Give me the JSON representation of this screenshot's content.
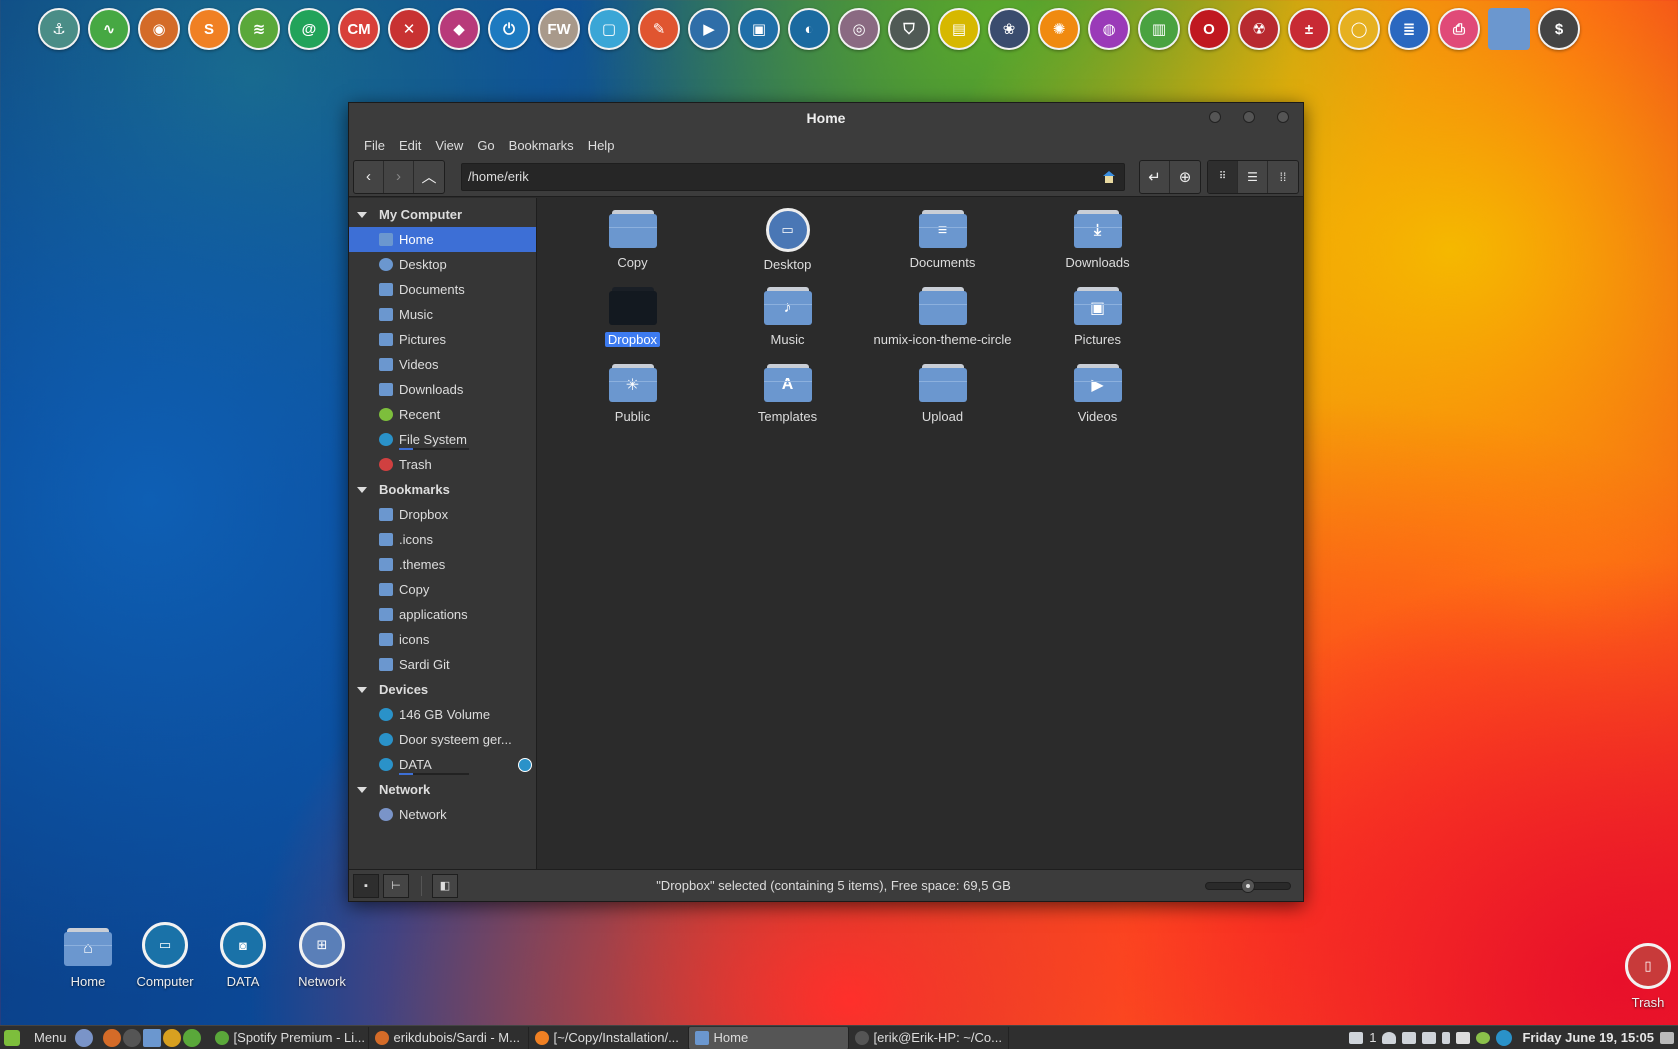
{
  "dock": {
    "items": [
      {
        "name": "anchor",
        "color": "#4a8d87",
        "glyph": "⚓"
      },
      {
        "name": "system-monitor",
        "color": "#46a843",
        "glyph": "∿"
      },
      {
        "name": "firefox",
        "color": "#d46b28",
        "glyph": "◉"
      },
      {
        "name": "sublime",
        "color": "#f08023",
        "glyph": "S"
      },
      {
        "name": "spotify",
        "color": "#5aa83a",
        "glyph": "≋"
      },
      {
        "name": "email",
        "color": "#22a35a",
        "glyph": "@"
      },
      {
        "name": "cm",
        "color": "#d8403a",
        "glyph": "CM"
      },
      {
        "name": "tools",
        "color": "#c83232",
        "glyph": "✕"
      },
      {
        "name": "inkscape",
        "color": "#b83a7a",
        "glyph": "◆"
      },
      {
        "name": "power",
        "color": "#1d7ac0",
        "glyph": "⏻"
      },
      {
        "name": "fireworks",
        "color": "#a8998a",
        "glyph": "FW"
      },
      {
        "name": "screenshot",
        "color": "#3aa6d6",
        "glyph": "▢"
      },
      {
        "name": "editor",
        "color": "#e05530",
        "glyph": "✎"
      },
      {
        "name": "video-editor",
        "color": "#2f6ea8",
        "glyph": "▶"
      },
      {
        "name": "image-viewer",
        "color": "#1f6fa8",
        "glyph": "▣"
      },
      {
        "name": "thunderbird",
        "color": "#1b6aa0",
        "glyph": "◐"
      },
      {
        "name": "disc",
        "color": "#8a6a82",
        "glyph": "◎"
      },
      {
        "name": "shield",
        "color": "#505a55",
        "glyph": "⛉"
      },
      {
        "name": "ruler",
        "color": "#d6b800",
        "glyph": "▤"
      },
      {
        "name": "network-circle",
        "color": "#3a4c6e",
        "glyph": "❀"
      },
      {
        "name": "citrus",
        "color": "#f08a10",
        "glyph": "✺"
      },
      {
        "name": "disk-tool",
        "color": "#9a3ab8",
        "glyph": "◍"
      },
      {
        "name": "hardware-card",
        "color": "#4aa240",
        "glyph": "▥"
      },
      {
        "name": "opera",
        "color": "#c01820",
        "glyph": "O"
      },
      {
        "name": "radiation",
        "color": "#b82a30",
        "glyph": "☢"
      },
      {
        "name": "calculator",
        "color": "#c82a34",
        "glyph": "±"
      },
      {
        "name": "chrome",
        "color": "#e6b020",
        "glyph": "◯"
      },
      {
        "name": "news",
        "color": "#2a68c0",
        "glyph": "≣"
      },
      {
        "name": "printer",
        "color": "#e04a78",
        "glyph": "⎙"
      },
      {
        "name": "folder",
        "color": "#6b97cf",
        "glyph": ""
      },
      {
        "name": "terminal",
        "color": "#444444",
        "glyph": "$"
      }
    ]
  },
  "window": {
    "title": "Home",
    "menu": [
      "File",
      "Edit",
      "View",
      "Go",
      "Bookmarks",
      "Help"
    ],
    "location": "/home/erik",
    "sidebar": {
      "sections": [
        {
          "title": "My Computer",
          "items": [
            {
              "label": "Home",
              "selected": true
            },
            {
              "label": "Desktop"
            },
            {
              "label": "Documents"
            },
            {
              "label": "Music"
            },
            {
              "label": "Pictures"
            },
            {
              "label": "Videos"
            },
            {
              "label": "Downloads"
            },
            {
              "label": "Recent"
            },
            {
              "label": "File System",
              "usage": 0.2
            },
            {
              "label": "Trash"
            }
          ]
        },
        {
          "title": "Bookmarks",
          "items": [
            {
              "label": "Dropbox"
            },
            {
              "label": ".icons"
            },
            {
              "label": ".themes"
            },
            {
              "label": "Copy"
            },
            {
              "label": "applications"
            },
            {
              "label": "icons"
            },
            {
              "label": "Sardi Git"
            }
          ]
        },
        {
          "title": "Devices",
          "items": [
            {
              "label": "146 GB Volume"
            },
            {
              "label": "Door systeem ger..."
            },
            {
              "label": "DATA",
              "usage": 0.2,
              "eject": true
            }
          ]
        },
        {
          "title": "Network",
          "items": [
            {
              "label": "Network"
            }
          ]
        }
      ]
    },
    "files": [
      {
        "name": "Copy",
        "glyph": ""
      },
      {
        "name": "Desktop",
        "glyph": "▭",
        "type": "circle"
      },
      {
        "name": "Documents",
        "glyph": "≡"
      },
      {
        "name": "Downloads",
        "glyph": "⤓"
      },
      {
        "name": "Dropbox",
        "glyph": "",
        "type": "dark",
        "selected": true
      },
      {
        "name": "Music",
        "glyph": "♪"
      },
      {
        "name": "numix-icon-theme-circle",
        "glyph": ""
      },
      {
        "name": "Pictures",
        "glyph": "▣"
      },
      {
        "name": "Public",
        "glyph": "✳"
      },
      {
        "name": "Templates",
        "glyph": "A"
      },
      {
        "name": "Upload",
        "glyph": ""
      },
      {
        "name": "Videos",
        "glyph": "▶"
      }
    ],
    "status": "\"Dropbox\" selected (containing 5 items), Free space: 69,5 GB",
    "zoom_level": 0.5
  },
  "desktop_icons": [
    {
      "label": "Home"
    },
    {
      "label": "Computer"
    },
    {
      "label": "DATA"
    },
    {
      "label": "Network"
    },
    {
      "label": "Trash"
    }
  ],
  "taskbar": {
    "menu_label": "Menu",
    "tasks": [
      {
        "label": "[Spotify Premium - Li...",
        "color": "#5aa83a"
      },
      {
        "label": "erikdubois/Sardi - M...",
        "color": "#d46b28"
      },
      {
        "label": "[~/Copy/Installation/...",
        "color": "#f08023"
      },
      {
        "label": "Home",
        "color": "#6b97cf",
        "active": true
      },
      {
        "label": "[erik@Erik-HP: ~/Co...",
        "color": "#555555"
      }
    ],
    "notification_count": "1",
    "clock": "Friday June 19, 15:05"
  }
}
